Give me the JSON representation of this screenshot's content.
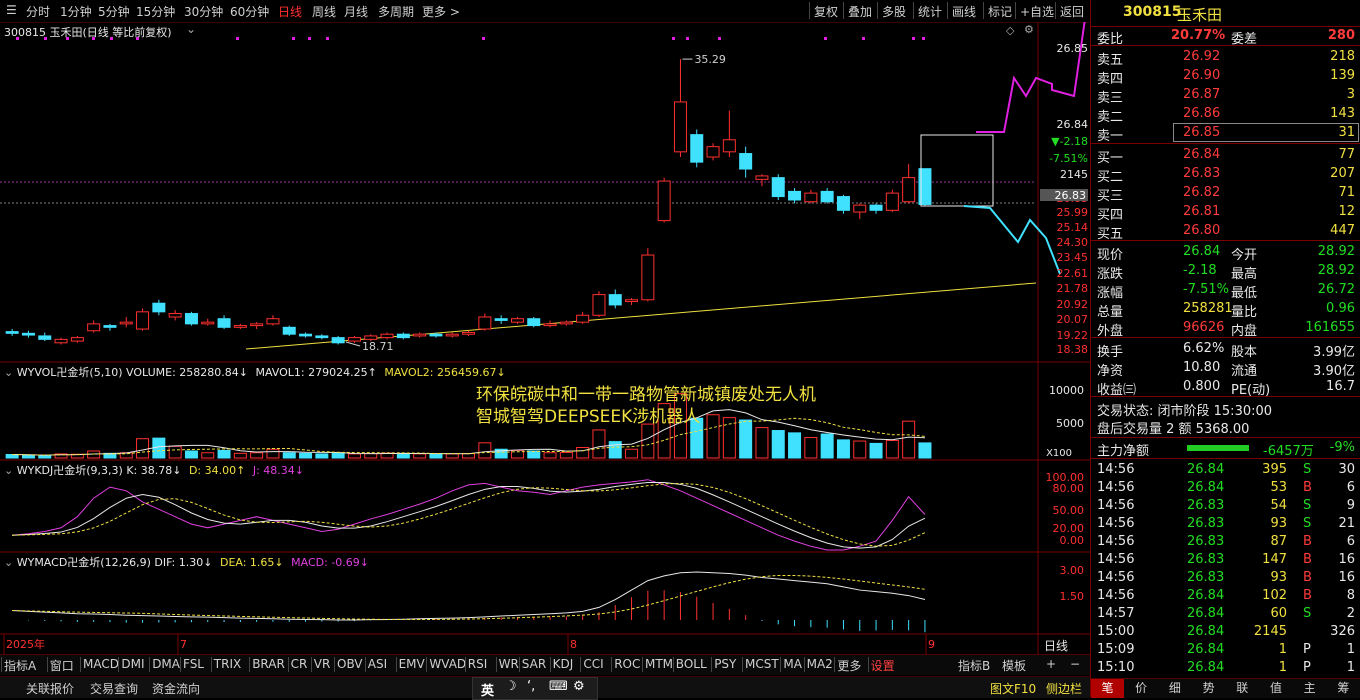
{
  "toolbar": {
    "periods": [
      "分时",
      "1分钟",
      "5分钟",
      "15分钟",
      "30分钟",
      "60分钟",
      "日线",
      "周线",
      "月线",
      "多周期",
      "更多 >"
    ],
    "active_period": "日线",
    "actions": [
      "复权",
      "叠加",
      "多股",
      "统计",
      "画线",
      "标记",
      "+自选",
      "返回"
    ]
  },
  "stock": {
    "code": "300815",
    "name": "玉禾田",
    "chart_title": "300815 玉禾田(日线 等比前复权)"
  },
  "price_chart": {
    "high_label": "35.29",
    "low_label": "18.71",
    "right_axis": [
      "26.85",
      "26.84",
      "▼-2.18",
      "-7.51%",
      "2145",
      "26.83",
      "25.99",
      "25.14",
      "24.30",
      "23.45",
      "22.61",
      "21.78",
      "20.92",
      "20.07",
      "19.22",
      "18.38"
    ],
    "axis_colors": {
      "up": "#ff3030",
      "down": "#40e0ff",
      "ma": "#f0e040"
    }
  },
  "candles": [
    {
      "o": 19.45,
      "c": 19.35,
      "h": 19.6,
      "l": 19.2
    },
    {
      "o": 19.35,
      "c": 19.25,
      "h": 19.5,
      "l": 19.1
    },
    {
      "o": 19.2,
      "c": 19.0,
      "h": 19.4,
      "l": 18.9
    },
    {
      "o": 18.8,
      "c": 19.0,
      "h": 19.1,
      "l": 18.7
    },
    {
      "o": 18.9,
      "c": 19.1,
      "h": 19.2,
      "l": 18.8
    },
    {
      "o": 19.5,
      "c": 19.9,
      "h": 20.1,
      "l": 19.4
    },
    {
      "o": 19.8,
      "c": 19.7,
      "h": 19.9,
      "l": 19.5
    },
    {
      "o": 19.9,
      "c": 20.0,
      "h": 20.3,
      "l": 19.7
    },
    {
      "o": 19.6,
      "c": 20.6,
      "h": 20.8,
      "l": 19.5
    },
    {
      "o": 21.1,
      "c": 20.6,
      "h": 21.3,
      "l": 20.4
    },
    {
      "o": 20.3,
      "c": 20.5,
      "h": 20.7,
      "l": 20.1
    },
    {
      "o": 20.5,
      "c": 19.9,
      "h": 20.6,
      "l": 19.8
    },
    {
      "o": 19.9,
      "c": 20.0,
      "h": 20.2,
      "l": 19.8
    },
    {
      "o": 20.2,
      "c": 19.7,
      "h": 20.4,
      "l": 19.6
    },
    {
      "o": 19.7,
      "c": 19.8,
      "h": 19.9,
      "l": 19.6
    },
    {
      "o": 19.8,
      "c": 19.9,
      "h": 20.0,
      "l": 19.6
    },
    {
      "o": 19.9,
      "c": 20.2,
      "h": 20.4,
      "l": 19.8
    },
    {
      "o": 19.7,
      "c": 19.3,
      "h": 19.8,
      "l": 19.2
    },
    {
      "o": 19.3,
      "c": 19.2,
      "h": 19.4,
      "l": 19.1
    },
    {
      "o": 19.2,
      "c": 19.1,
      "h": 19.3,
      "l": 19.0
    },
    {
      "o": 19.1,
      "c": 18.8,
      "h": 19.2,
      "l": 18.7
    },
    {
      "o": 18.9,
      "c": 19.1,
      "h": 19.2,
      "l": 18.8
    },
    {
      "o": 19.0,
      "c": 19.2,
      "h": 19.3,
      "l": 18.9
    },
    {
      "o": 19.1,
      "c": 19.3,
      "h": 19.4,
      "l": 19.0
    },
    {
      "o": 19.3,
      "c": 19.1,
      "h": 19.4,
      "l": 19.0
    },
    {
      "o": 19.2,
      "c": 19.3,
      "h": 19.4,
      "l": 19.1
    },
    {
      "o": 19.3,
      "c": 19.2,
      "h": 19.4,
      "l": 19.1
    },
    {
      "o": 19.2,
      "c": 19.3,
      "h": 19.4,
      "l": 19.1
    },
    {
      "o": 19.3,
      "c": 19.4,
      "h": 19.5,
      "l": 19.2
    },
    {
      "o": 19.6,
      "c": 20.3,
      "h": 20.5,
      "l": 19.5
    },
    {
      "o": 20.2,
      "c": 20.1,
      "h": 20.4,
      "l": 19.9
    },
    {
      "o": 20.0,
      "c": 20.2,
      "h": 20.3,
      "l": 19.9
    },
    {
      "o": 20.2,
      "c": 19.8,
      "h": 20.3,
      "l": 19.7
    },
    {
      "o": 19.8,
      "c": 19.9,
      "h": 20.1,
      "l": 19.7
    },
    {
      "o": 19.9,
      "c": 20.0,
      "h": 20.1,
      "l": 19.8
    },
    {
      "o": 20.0,
      "c": 20.4,
      "h": 20.6,
      "l": 19.9
    },
    {
      "o": 20.4,
      "c": 21.6,
      "h": 21.8,
      "l": 20.3
    },
    {
      "o": 21.6,
      "c": 21.0,
      "h": 21.9,
      "l": 20.8
    },
    {
      "o": 21.2,
      "c": 21.3,
      "h": 21.4,
      "l": 21.0
    },
    {
      "o": 21.3,
      "c": 23.9,
      "h": 24.3,
      "l": 21.2
    },
    {
      "o": 25.9,
      "c": 28.2,
      "h": 28.4,
      "l": 25.8
    },
    {
      "o": 29.9,
      "c": 32.8,
      "h": 35.29,
      "l": 29.6
    },
    {
      "o": 30.9,
      "c": 29.3,
      "h": 31.2,
      "l": 29.0
    },
    {
      "o": 29.6,
      "c": 30.2,
      "h": 30.4,
      "l": 29.4
    },
    {
      "o": 29.9,
      "c": 30.6,
      "h": 32.3,
      "l": 29.6
    },
    {
      "o": 29.8,
      "c": 28.9,
      "h": 30.2,
      "l": 28.4
    },
    {
      "o": 28.3,
      "c": 28.5,
      "h": 28.6,
      "l": 27.9
    },
    {
      "o": 28.4,
      "c": 27.3,
      "h": 28.6,
      "l": 27.1
    },
    {
      "o": 27.6,
      "c": 27.1,
      "h": 27.8,
      "l": 26.9
    },
    {
      "o": 27.0,
      "c": 27.5,
      "h": 27.7,
      "l": 26.9
    },
    {
      "o": 27.6,
      "c": 27.0,
      "h": 27.8,
      "l": 26.9
    },
    {
      "o": 27.3,
      "c": 26.5,
      "h": 27.4,
      "l": 26.3
    },
    {
      "o": 26.4,
      "c": 26.8,
      "h": 26.9,
      "l": 26.0
    },
    {
      "o": 26.8,
      "c": 26.5,
      "h": 26.9,
      "l": 26.3
    },
    {
      "o": 26.5,
      "c": 27.5,
      "h": 27.7,
      "l": 26.4
    },
    {
      "o": 27.0,
      "c": 28.4,
      "h": 29.2,
      "l": 26.9
    },
    {
      "o": 28.92,
      "c": 26.84,
      "h": 28.92,
      "l": 26.72
    }
  ],
  "annotation": {
    "line1": "环保皖碳中和一带一路物管新城镇废处无人机",
    "line2": "智城智驾DEEPSEEK涉机器人"
  },
  "volume_panel": {
    "title": "WYVOL卍金圻(5,10)",
    "volume": "VOLUME: 258280.84↓",
    "mavol1": "MAVOL1: 279024.25↑",
    "mavol2": "MAVOL2: 256459.67↓",
    "right_axis": [
      "10000",
      "5000",
      "X100"
    ]
  },
  "kdj_panel": {
    "title": "WYKDJ卍金圻(9,3,3)",
    "k": "K: 38.78↓",
    "d": "D: 34.00↑",
    "j": "J: 48.34↓",
    "right_axis": [
      "100.00",
      "80.00",
      "50.00",
      "20.00",
      "0.00"
    ]
  },
  "macd_panel": {
    "title": "WYMACD卍金圻(12,26,9)",
    "dif": "DIF: 1.30↓",
    "dea": "DEA: 1.65↓",
    "macd": "MACD: -0.69↓",
    "right_axis": [
      "3.00",
      "1.50"
    ]
  },
  "time_axis": {
    "labels": [
      "2025年",
      "7",
      "8",
      "9"
    ],
    "right_label": "日线"
  },
  "indicator_tabs": [
    "指标A",
    "窗口",
    "MACD",
    "DMI",
    "DMA",
    "FSL",
    "TRIX",
    "BRAR",
    "CR",
    "VR",
    "OBV",
    "ASI",
    "EMV",
    "WVAD",
    "RSI",
    "WR",
    "SAR",
    "KDJ",
    "CCI",
    "ROC",
    "MTM",
    "BOLL",
    "PSY",
    "MCST",
    "MA",
    "MA2",
    "更多",
    "设置"
  ],
  "indicator_right": [
    "指标B",
    "模板",
    "+",
    "−"
  ],
  "statusbar": {
    "items": [
      "关联报价",
      "交易查询",
      "资金流向"
    ],
    "right": [
      "图文F10",
      "侧边栏"
    ],
    "ime": "英"
  },
  "quote": {
    "weibi_label": "委比",
    "weibi": "20.77%",
    "weicha_label": "委差",
    "weicha": "280",
    "asks": [
      {
        "l": "卖五",
        "p": "26.92",
        "v": "218"
      },
      {
        "l": "卖四",
        "p": "26.90",
        "v": "139"
      },
      {
        "l": "卖三",
        "p": "26.87",
        "v": "3"
      },
      {
        "l": "卖二",
        "p": "26.86",
        "v": "143"
      },
      {
        "l": "卖一",
        "p": "26.85",
        "v": "31"
      }
    ],
    "bids": [
      {
        "l": "买一",
        "p": "26.84",
        "v": "77"
      },
      {
        "l": "买二",
        "p": "26.83",
        "v": "207"
      },
      {
        "l": "买三",
        "p": "26.82",
        "v": "71"
      },
      {
        "l": "买四",
        "p": "26.81",
        "v": "12"
      },
      {
        "l": "买五",
        "p": "26.80",
        "v": "447"
      }
    ],
    "stats": [
      {
        "l1": "现价",
        "v1": "26.84",
        "c1": "green",
        "l2": "今开",
        "v2": "28.92",
        "c2": "green"
      },
      {
        "l1": "涨跌",
        "v1": "-2.18",
        "c1": "green",
        "l2": "最高",
        "v2": "28.92",
        "c2": "green"
      },
      {
        "l1": "涨幅",
        "v1": "-7.51%",
        "c1": "green",
        "l2": "最低",
        "v2": "26.72",
        "c2": "green"
      },
      {
        "l1": "总量",
        "v1": "258281",
        "c1": "yellow",
        "l2": "量比",
        "v2": "0.96",
        "c2": "green"
      },
      {
        "l1": "外盘",
        "v1": "96626",
        "c1": "red",
        "l2": "内盘",
        "v2": "161655",
        "c2": "green"
      }
    ],
    "stats2": [
      {
        "l1": "换手",
        "v1": "6.62%",
        "l2": "股本",
        "v2": "3.99亿"
      },
      {
        "l1": "净资",
        "v1": "10.80",
        "l2": "流通",
        "v2": "3.90亿"
      },
      {
        "l1": "收益㈢",
        "v1": "0.800",
        "l2": "PE(动)",
        "v2": "16.7"
      }
    ],
    "trade_status": "交易状态: 闭市阶段 15:30:00",
    "after_hours": "盘后交易量 2 额 5368.00",
    "main_flow_label": "主力净额",
    "main_flow": "-6457万",
    "main_flow_pct": "-9%"
  },
  "ticks": [
    {
      "t": "14:56",
      "p": "26.84",
      "v": "395",
      "s": "S",
      "n": "30"
    },
    {
      "t": "14:56",
      "p": "26.84",
      "v": "53",
      "s": "B",
      "n": "6"
    },
    {
      "t": "14:56",
      "p": "26.83",
      "v": "54",
      "s": "S",
      "n": "9"
    },
    {
      "t": "14:56",
      "p": "26.83",
      "v": "93",
      "s": "S",
      "n": "21"
    },
    {
      "t": "14:56",
      "p": "26.83",
      "v": "87",
      "s": "B",
      "n": "6"
    },
    {
      "t": "14:56",
      "p": "26.83",
      "v": "147",
      "s": "B",
      "n": "16"
    },
    {
      "t": "14:56",
      "p": "26.83",
      "v": "93",
      "s": "B",
      "n": "16"
    },
    {
      "t": "14:56",
      "p": "26.84",
      "v": "102",
      "s": "B",
      "n": "8"
    },
    {
      "t": "14:57",
      "p": "26.84",
      "v": "60",
      "s": "S",
      "n": "2"
    },
    {
      "t": "15:00",
      "p": "26.84",
      "v": "2145",
      "s": "",
      "n": "326"
    },
    {
      "t": "15:09",
      "p": "26.84",
      "v": "1",
      "s": "P",
      "n": "1"
    },
    {
      "t": "15:10",
      "p": "26.84",
      "v": "1",
      "s": "P",
      "n": "1"
    }
  ],
  "right_tabs": [
    "笔",
    "价",
    "细",
    "势",
    "联",
    "值",
    "主",
    "筹"
  ]
}
